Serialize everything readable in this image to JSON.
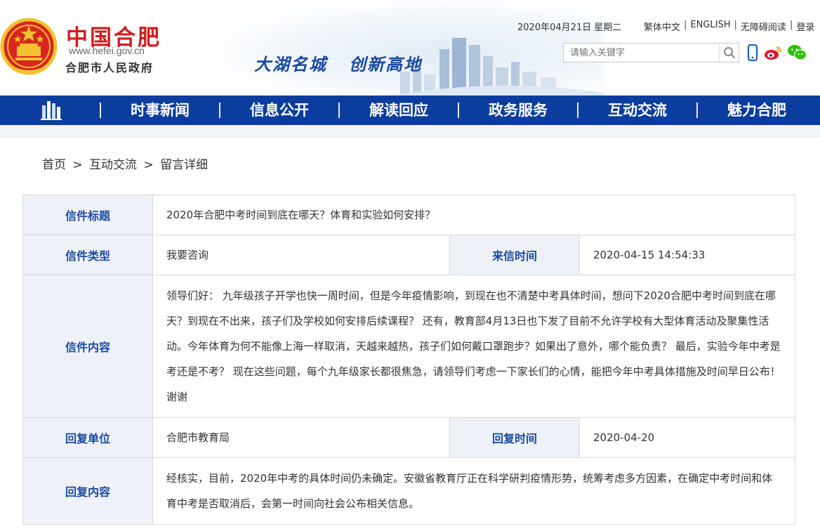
{
  "header": {
    "site_name": "中国合肥",
    "site_url": "www.hefei.gov.cn",
    "site_gov": "合肥市人民政府",
    "slogan": "大湖名城   创新高地",
    "date": "2020年04月21日 星期二",
    "top_links": [
      "繁体中文",
      "ENGLISH",
      "无障碍阅读",
      "登录"
    ],
    "search_placeholder": "请输入关键字",
    "icons": [
      "search-icon",
      "mobile-icon",
      "weibo-icon",
      "wechat-icon"
    ]
  },
  "nav": {
    "items": [
      "时事新闻",
      "信息公开",
      "解读回应",
      "政务服务",
      "互动交流",
      "魅力合肥"
    ]
  },
  "breadcrumb": {
    "items": [
      "首页",
      "互动交流",
      "留言详细"
    ],
    "separator": ">"
  },
  "letter": {
    "title_label": "信件标题",
    "title": "2020年合肥中考时间到底在哪天？体育和实验如何安排？",
    "type_label": "信件类型",
    "type": "我要咨询",
    "time_label": "来信时间",
    "time": "2020-04-15 14:54:33",
    "content_label": "信件内容",
    "content": "领导们好： 九年级孩子开学也快一周时间，但是今年疫情影响，到现在也不清楚中考具体时间，想问下2020合肥中考时间到底在哪天？到现在不出来，孩子们及学校如何安排后续课程？ 还有，教育部4月13日也下发了目前不允许学校有大型体育活动及聚集性活动。今年体育为何不能像上海一样取消，天越来越热，孩子们如何戴口罩跑步？如果出了意外，哪个能负责？ 最后，实验今年中考是考还是不考？ 现在这些问题，每个九年级家长都很焦急，请领导们考虑一下家长们的心情，能把今年中考具体措施及时间早日公布！谢谢",
    "reply_unit_label": "回复单位",
    "reply_unit": "合肥市教育局",
    "reply_time_label": "回复时间",
    "reply_time": "2020-04-20",
    "reply_content_label": "回复内容",
    "reply_content": "经核实，目前，2020年中考的具体时间仍未确定。安徽省教育厅正在科学研判疫情形势，统筹考虑多方因素，在确定中考时间和体育中考是否取消后，会第一时间向社会公布相关信息。"
  },
  "colors": {
    "brand_red": "#d01c1f",
    "nav_blue": "#0b3d9e",
    "label_blue": "#1a4a9e",
    "label_bg": "#eef2f8",
    "page_bg": "#f2f4f7"
  }
}
